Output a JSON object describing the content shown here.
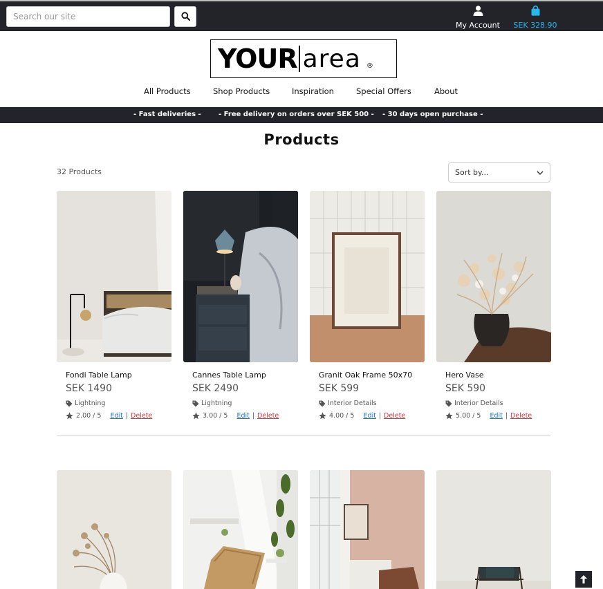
{
  "search": {
    "placeholder": "Search our site",
    "value": ""
  },
  "header": {
    "account_label": "My Account",
    "bag_label": "SEK 328.90",
    "bag_color": "#27b6f0"
  },
  "logo": {
    "bold_text": "YOUR",
    "light_text": "area",
    "reg_mark": "®"
  },
  "nav": {
    "items": [
      {
        "label": "All Products"
      },
      {
        "label": "Shop Products"
      },
      {
        "label": "Inspiration"
      },
      {
        "label": "Special Offers"
      },
      {
        "label": "About"
      }
    ]
  },
  "banner": {
    "items": [
      {
        "text": "- Fast deliveries -"
      },
      {
        "text": "- Free delivery on orders over SEK 500 -"
      },
      {
        "text": "- 30 days open purchase -"
      }
    ]
  },
  "main": {
    "title": "Products",
    "count_label": "32 Products",
    "sort_label": "Sort by..."
  },
  "products": [
    {
      "name": "Fondi Table Lamp",
      "price": "SEK 1490",
      "category": "Lightning",
      "rating": "2.00 / 5",
      "edit": "Edit",
      "separator": "|",
      "delete": "Delete"
    },
    {
      "name": "Cannes Table Lamp",
      "price": "SEK 2490",
      "category": "Lightning",
      "rating": "3.00 / 5",
      "edit": "Edit",
      "separator": "|",
      "delete": "Delete"
    },
    {
      "name": "Granit Oak Frame 50x70",
      "price": "SEK 599",
      "category": "Interior Details",
      "rating": "4.00 / 5",
      "edit": "Edit",
      "separator": "|",
      "delete": "Delete"
    },
    {
      "name": "Hero Vase",
      "price": "SEK 590",
      "category": "Interior Details",
      "rating": "5.00 / 5",
      "edit": "Edit",
      "separator": "|",
      "delete": "Delete"
    }
  ],
  "colors": {
    "topbar_bg": "#222429",
    "edit_link": "#1f6fe0",
    "delete_link": "#d4343a"
  }
}
